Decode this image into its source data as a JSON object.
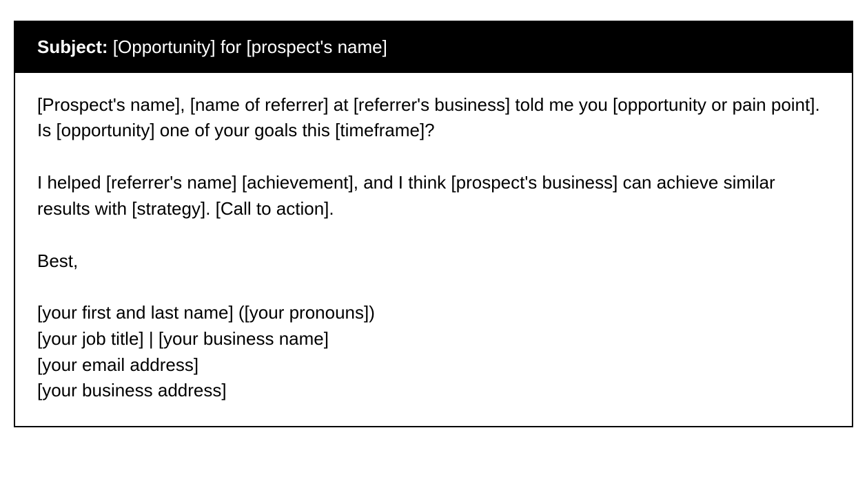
{
  "subject": {
    "label": "Subject:",
    "text": " [Opportunity] for [prospect's name]"
  },
  "body": {
    "paragraph1": "[Prospect's name], [name of referrer] at [referrer's business] told me you [opportunity or pain point]. Is [opportunity] one of your goals this [timeframe]?",
    "paragraph2": "I helped [referrer's name] [achievement], and I think [prospect's business] can achieve similar results with [strategy]. [Call to action].",
    "closing": "Best,",
    "signature": {
      "line1": "[your first and last name] ([your pronouns])",
      "line2": "[your job title] | [your business name]",
      "line3": "[your email address]",
      "line4": "[your business address]"
    }
  }
}
